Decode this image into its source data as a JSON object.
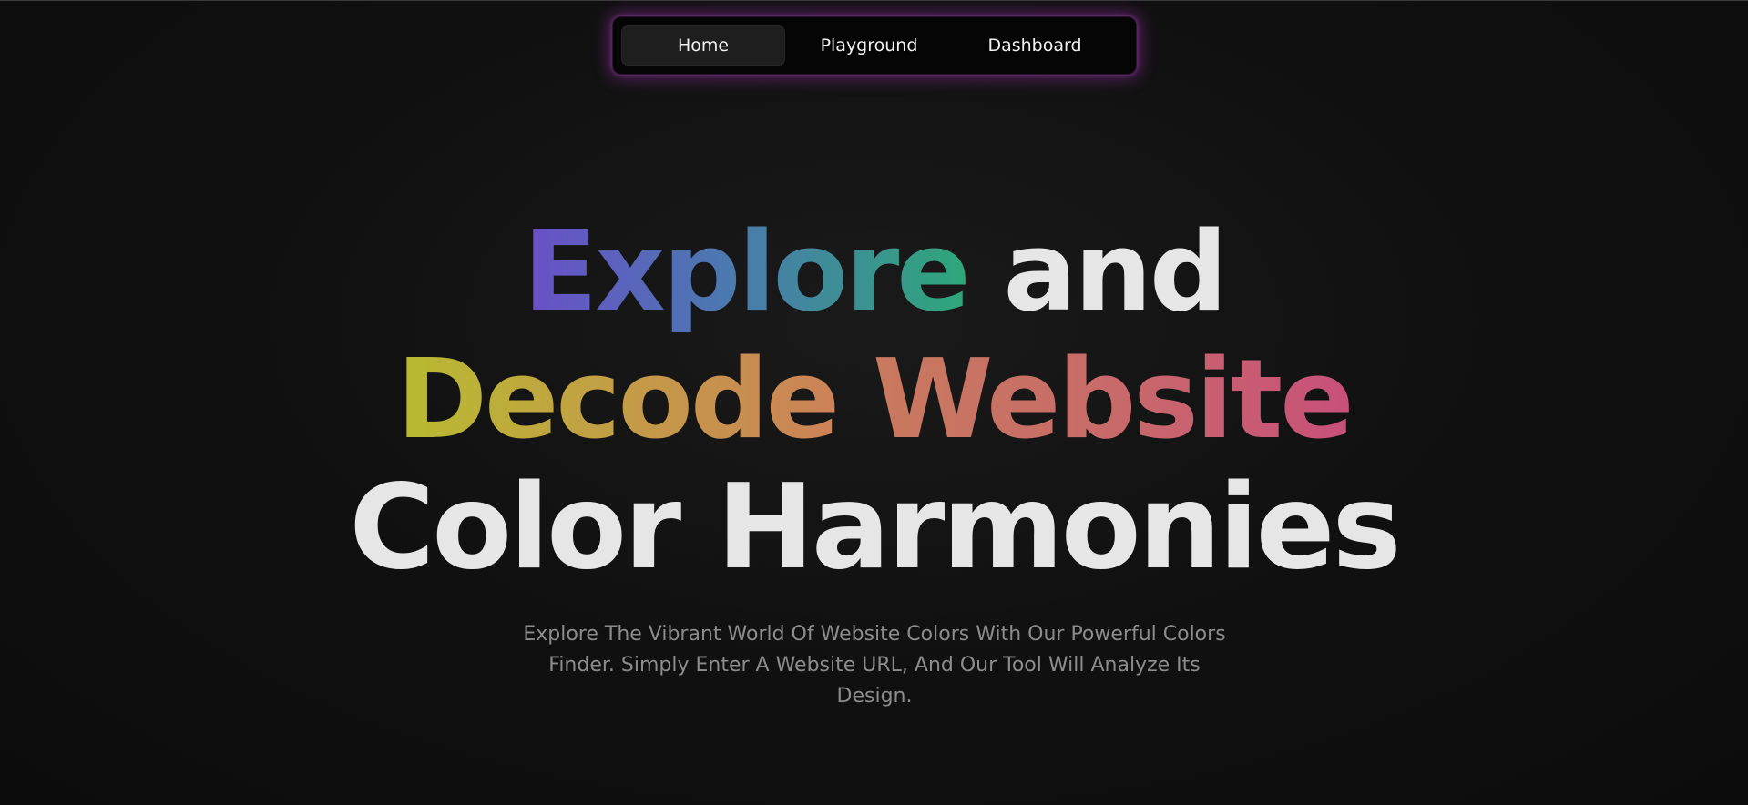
{
  "nav": {
    "items": [
      {
        "label": "Home",
        "active": true
      },
      {
        "label": "Playground",
        "active": false
      },
      {
        "label": "Dashboard",
        "active": false
      }
    ],
    "glow_color": "#b034c4"
  },
  "hero": {
    "line1": {
      "word1": "Explore",
      "word2": "and"
    },
    "line2": {
      "word1": "Decode",
      "word2": "Website"
    },
    "line3": {
      "text": "Color Harmonies"
    },
    "colors": {
      "explore": [
        "#6a4fc8",
        "#4b78b0",
        "#2ea779"
      ],
      "decode": [
        "#b8bb30",
        "#c49a48",
        "#cc8258"
      ],
      "website": [
        "#c97a5e",
        "#c86a6a",
        "#c8507a"
      ],
      "plain": "#e6e6e6"
    }
  },
  "subtitle": {
    "text": "Explore The Vibrant World Of Website Colors With Our Powerful Colors Finder. Simply Enter A Website URL, And Our Tool Will Analyze Its Design."
  }
}
